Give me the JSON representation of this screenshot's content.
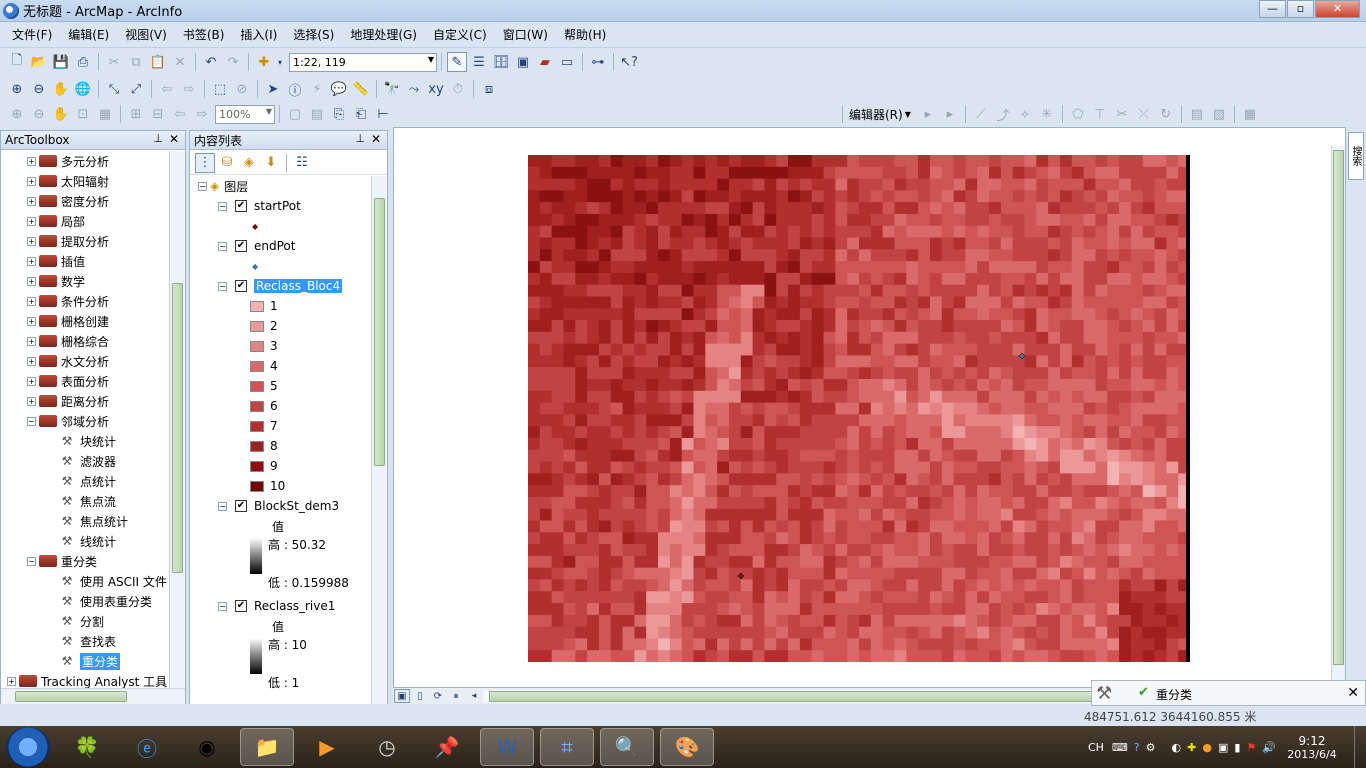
{
  "window": {
    "title": "无标题 - ArcMap - ArcInfo",
    "min": "—",
    "max": "▫",
    "close": "✕"
  },
  "menu": [
    "文件(F)",
    "编辑(E)",
    "视图(V)",
    "书签(B)",
    "插入(I)",
    "选择(S)",
    "地理处理(G)",
    "自定义(C)",
    "窗口(W)",
    "帮助(H)"
  ],
  "toolbar": {
    "scale": "1:22, 119",
    "zoom_percent": "100%",
    "editor_label": "编辑器(R)"
  },
  "arctoolbox": {
    "title": "ArcToolbox",
    "items": [
      {
        "label": "多元分析",
        "type": "toolbox",
        "level": 1,
        "exp": "+"
      },
      {
        "label": "太阳辐射",
        "type": "toolbox",
        "level": 1,
        "exp": "+"
      },
      {
        "label": "密度分析",
        "type": "toolbox",
        "level": 1,
        "exp": "+"
      },
      {
        "label": "局部",
        "type": "toolbox",
        "level": 1,
        "exp": "+"
      },
      {
        "label": "提取分析",
        "type": "toolbox",
        "level": 1,
        "exp": "+"
      },
      {
        "label": "插值",
        "type": "toolbox",
        "level": 1,
        "exp": "+"
      },
      {
        "label": "数学",
        "type": "toolbox",
        "level": 1,
        "exp": "+"
      },
      {
        "label": "条件分析",
        "type": "toolbox",
        "level": 1,
        "exp": "+"
      },
      {
        "label": "栅格创建",
        "type": "toolbox",
        "level": 1,
        "exp": "+"
      },
      {
        "label": "栅格综合",
        "type": "toolbox",
        "level": 1,
        "exp": "+"
      },
      {
        "label": "水文分析",
        "type": "toolbox",
        "level": 1,
        "exp": "+"
      },
      {
        "label": "表面分析",
        "type": "toolbox",
        "level": 1,
        "exp": "+"
      },
      {
        "label": "距离分析",
        "type": "toolbox",
        "level": 1,
        "exp": "+"
      },
      {
        "label": "邻域分析",
        "type": "toolbox",
        "level": 1,
        "exp": "−"
      },
      {
        "label": "块统计",
        "type": "tool",
        "level": 2
      },
      {
        "label": "滤波器",
        "type": "tool",
        "level": 2
      },
      {
        "label": "点统计",
        "type": "tool",
        "level": 2
      },
      {
        "label": "焦点流",
        "type": "tool",
        "level": 2
      },
      {
        "label": "焦点统计",
        "type": "tool",
        "level": 2
      },
      {
        "label": "线统计",
        "type": "tool",
        "level": 2
      },
      {
        "label": "重分类",
        "type": "toolbox",
        "level": 1,
        "exp": "−"
      },
      {
        "label": "使用 ASCII 文件",
        "type": "tool",
        "level": 2
      },
      {
        "label": "使用表重分类",
        "type": "tool",
        "level": 2
      },
      {
        "label": "分割",
        "type": "tool",
        "level": 2
      },
      {
        "label": "查找表",
        "type": "tool",
        "level": 2
      },
      {
        "label": "重分类",
        "type": "tool",
        "level": 2,
        "selected": true
      },
      {
        "label": "Tracking Analyst 工具",
        "type": "toolbox",
        "level": 0,
        "exp": "+"
      }
    ]
  },
  "toc": {
    "title": "内容列表",
    "root_label": "图层",
    "layers": [
      {
        "name": "startPot",
        "symbol_color": "#7a1010"
      },
      {
        "name": "endPot",
        "symbol_color": "#2f7fa0"
      },
      {
        "name": "Reclass_Bloc4",
        "selected": true,
        "classes": [
          {
            "label": "1",
            "color": "#f3b3b3"
          },
          {
            "label": "2",
            "color": "#ec9898"
          },
          {
            "label": "3",
            "color": "#e58383"
          },
          {
            "label": "4",
            "color": "#da6a6a"
          },
          {
            "label": "5",
            "color": "#cf5555"
          },
          {
            "label": "6",
            "color": "#c24343"
          },
          {
            "label": "7",
            "color": "#b22f2f"
          },
          {
            "label": "8",
            "color": "#a01f1f"
          },
          {
            "label": "9",
            "color": "#8c1212"
          },
          {
            "label": "10",
            "color": "#700808"
          }
        ]
      },
      {
        "name": "BlockSt_dem3",
        "value_label": "值",
        "high": "高 : 50.32",
        "low": "低 : 0.159988"
      },
      {
        "name": "Reclass_rive1",
        "value_label": "值",
        "high": "高 : 10",
        "low": "低 : 1"
      }
    ]
  },
  "right_tab": "搜索",
  "status": {
    "coords": "484751.612  3644160.855 米"
  },
  "notification": {
    "label": "重分类",
    "close": "✕"
  },
  "tray": {
    "lang": "CH",
    "time": "9:12",
    "date": "2013/6/4"
  },
  "colors": {
    "accent_select": "#3399ff",
    "titlebar": "#c9dcf2",
    "raster_base": "#cf5a5a"
  }
}
